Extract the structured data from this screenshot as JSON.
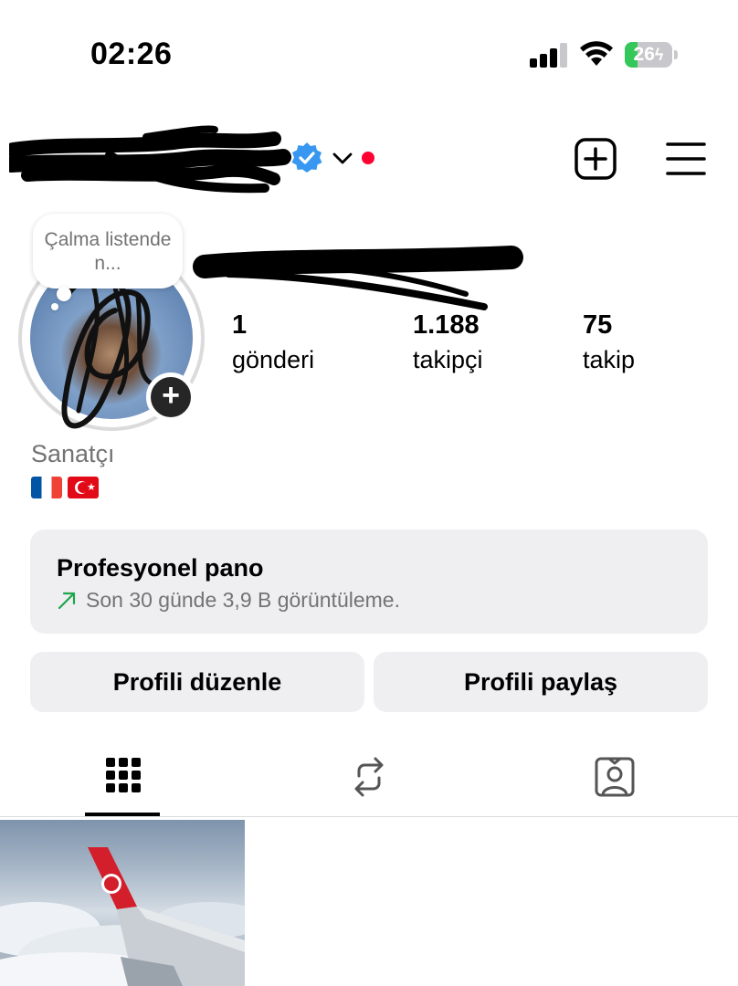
{
  "status_bar": {
    "time": "02:26",
    "battery_level": "26",
    "battery_percent": 26,
    "battery_charging": true,
    "signal_bars": 3,
    "icons": [
      "signal-icon",
      "wifi-icon",
      "battery-charging-icon"
    ]
  },
  "header": {
    "verified": true,
    "notification_dot": true,
    "icons": [
      "verified-badge-icon",
      "chevron-down-icon",
      "create-plus-icon",
      "hamburger-menu-icon"
    ]
  },
  "profile": {
    "note_text": "Çalma listende n...",
    "category": "Sanatçı",
    "flags": [
      "france-flag",
      "turkey-flag"
    ]
  },
  "stats": [
    {
      "value": "1",
      "label": "gönderi"
    },
    {
      "value": "1.188",
      "label": "takipçi"
    },
    {
      "value": "75",
      "label": "takip"
    }
  ],
  "dashboard": {
    "title": "Profesyonel pano",
    "subtitle": "Son 30 günde 3,9 B görüntüleme."
  },
  "actions": {
    "edit_label": "Profili düzenle",
    "share_label": "Profili paylaş"
  },
  "tabs": [
    {
      "icon": "grid-icon",
      "active": true
    },
    {
      "icon": "reposts-icon",
      "active": false
    },
    {
      "icon": "tagged-icon",
      "active": false
    }
  ],
  "colors": {
    "accent_verified": "#3897f0",
    "notification_dot": "#ff0033",
    "button_bg": "#efeff2",
    "secondary_text": "#737373",
    "battery_green": "#34c759"
  }
}
